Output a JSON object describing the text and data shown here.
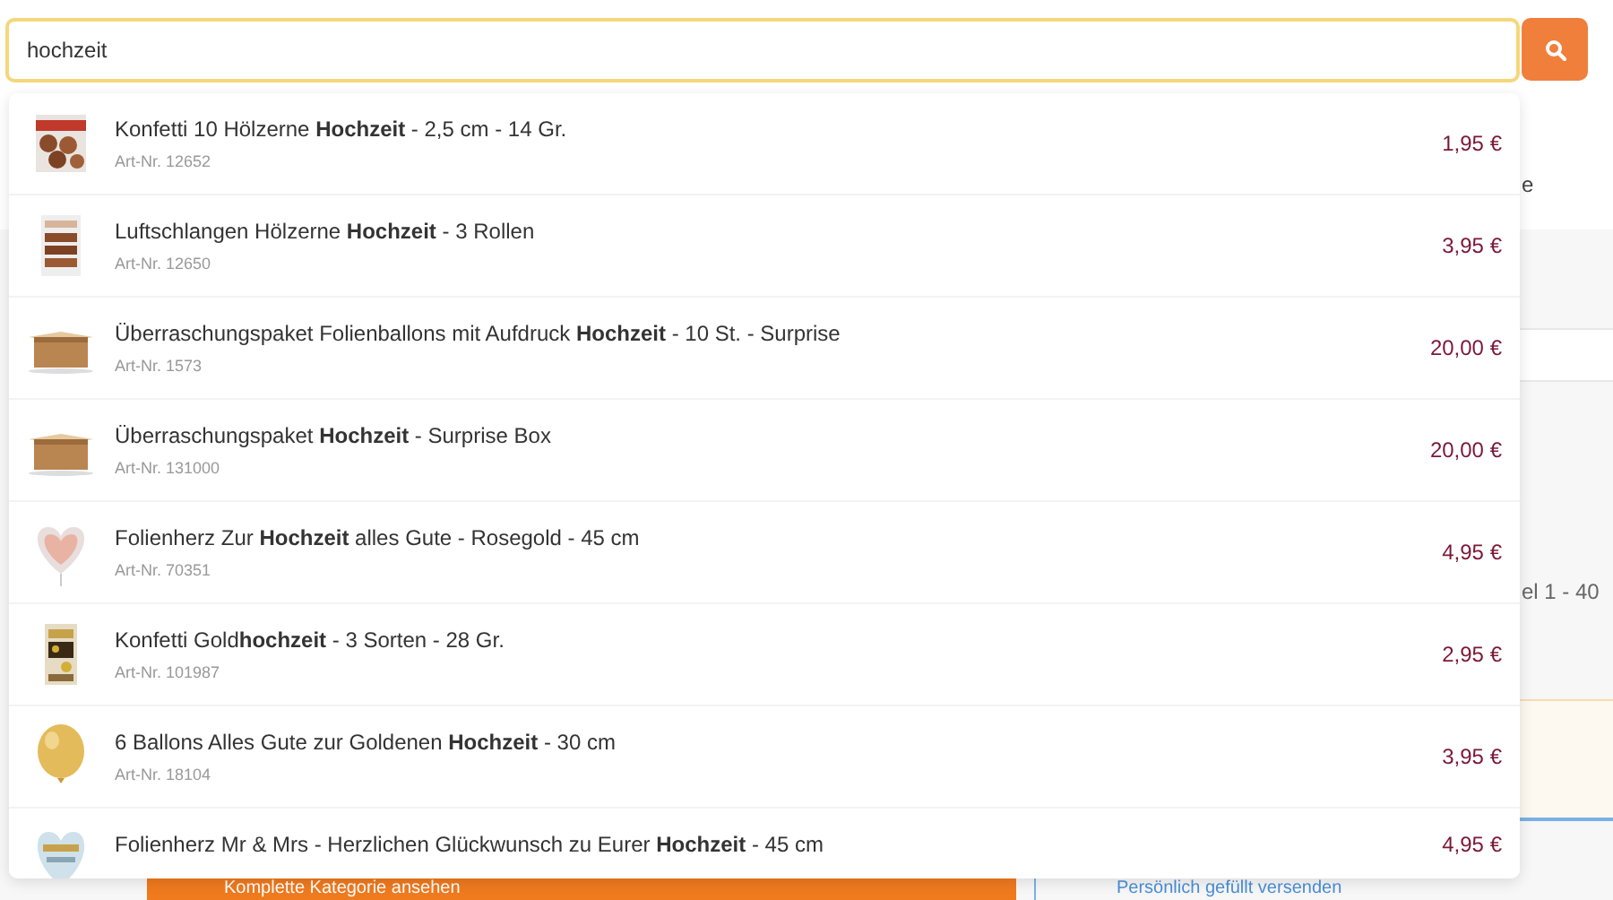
{
  "search": {
    "value": "hochzeit"
  },
  "background": {
    "right_fragment": "e",
    "count_fragment": "el 1 - 40",
    "category_button": "Komplette Kategorie ansehen",
    "link": "Persönlich gefüllt versenden"
  },
  "suggestions": [
    {
      "title": "Konfetti 10 Hölzerne **Hochzeit** - 2,5 cm - 14 Gr.",
      "article": "Art-Nr. 12652",
      "price": "1,95 €"
    },
    {
      "title": "Luftschlangen Hölzerne **Hochzeit** - 3 Rollen",
      "article": "Art-Nr. 12650",
      "price": "3,95 €"
    },
    {
      "title": "Überraschungspaket Folienballons mit Aufdruck **Hochzeit** - 10 St. - Surprise",
      "article": "Art-Nr. 1573",
      "price": "20,00 €"
    },
    {
      "title": "Überraschungspaket **Hochzeit** - Surprise Box",
      "article": "Art-Nr. 131000",
      "price": "20,00 €"
    },
    {
      "title": "Folienherz Zur **Hochzeit** alles Gute - Rosegold - 45 cm",
      "article": "Art-Nr. 70351",
      "price": "4,95 €"
    },
    {
      "title": "Konfetti Gold**hochzeit** - 3 Sorten - 28 Gr.",
      "article": "Art-Nr. 101987",
      "price": "2,95 €"
    },
    {
      "title": "6 Ballons Alles Gute zur Goldenen **Hochzeit** - 30 cm",
      "article": "Art-Nr. 18104",
      "price": "3,95 €"
    },
    {
      "title": "Folienherz Mr & Mrs - Herzlichen Glückwunsch zu Eurer **Hochzeit** - 45 cm",
      "price": "4,95 €"
    }
  ]
}
